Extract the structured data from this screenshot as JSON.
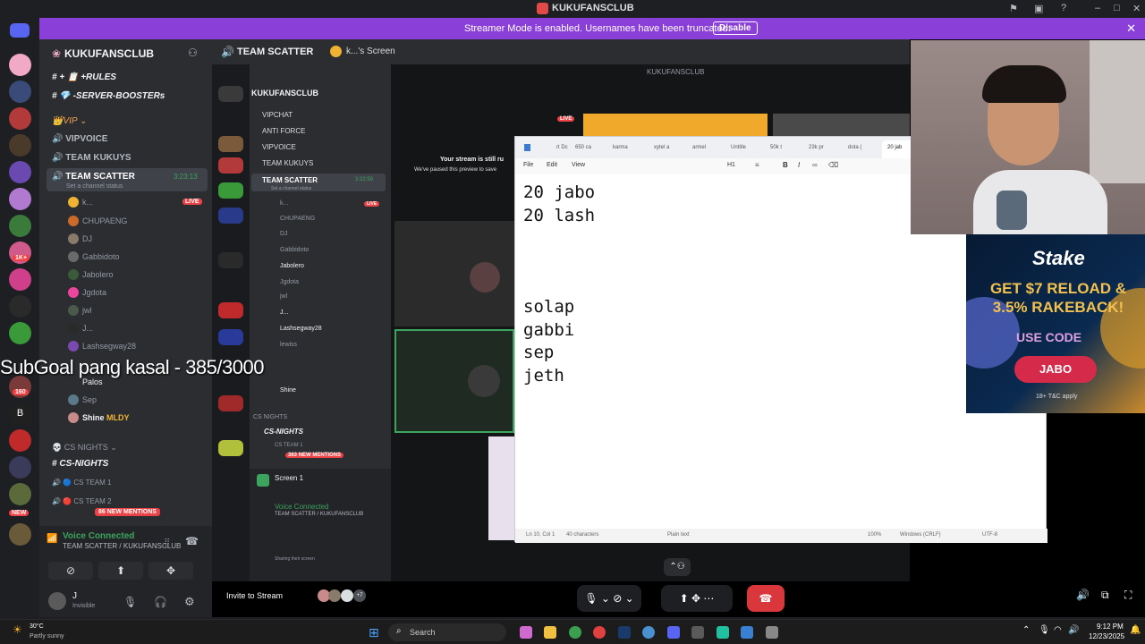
{
  "window": {
    "title": "KUKUFANSCLUB"
  },
  "streamer_bar": {
    "message": "Streamer Mode is enabled. Usernames have been truncated.",
    "button": "Disable"
  },
  "rail": {
    "badges": [
      "1K+",
      "160",
      "NEW"
    ]
  },
  "server": {
    "name": "KUKUFANSCLUB",
    "channels_top": [
      {
        "name": "+ 📋 +RULES"
      },
      {
        "name": "💎 -SERVER-BOOSTERs"
      }
    ],
    "category_vip": "VIP",
    "vip_channels": [
      "VIPVOICE",
      "TEAM KUKUYS",
      "TEAM SCATTER"
    ],
    "selected_channel": "TEAM SCATTER",
    "selected_time": "3:23:13",
    "channel_status": "Set a channel status",
    "voice_users": [
      {
        "name": "k...",
        "live": "LIVE"
      },
      {
        "name": "CHUPAENG"
      },
      {
        "name": "DJ"
      },
      {
        "name": "Gabbidoto"
      },
      {
        "name": "Jabolero"
      },
      {
        "name": "Jgdota"
      },
      {
        "name": "jwl"
      },
      {
        "name": "J..."
      },
      {
        "name": "Lashsegway28"
      },
      {
        "name": "Palos"
      },
      {
        "name": "Sep"
      },
      {
        "name": "Shine"
      }
    ],
    "shine_tag": "MLDY",
    "category_cs": "CS NIGHTS",
    "cs_channels": [
      "CS-NIGHTS",
      "CS TEAM 1",
      "CS TEAM 2"
    ],
    "new_mentions": "86 NEW MENTIONS"
  },
  "voice_panel": {
    "status": "Voice Connected",
    "location": "TEAM SCATTER / KUKUFANSCLUB"
  },
  "user_panel": {
    "name": "J",
    "status": "Invisible"
  },
  "main_header": {
    "channel": "TEAM SCATTER",
    "screen": "k...'s Screen"
  },
  "nested": {
    "server_title": "KUKUFANSCLUB",
    "channels": [
      "VIPCHAT",
      "ANTI FORCE",
      "VIPVOICE",
      "TEAM KUKUYS",
      "TEAM SCATTER"
    ],
    "selected_time": "3:22:59",
    "channel_status": "Set a channel status",
    "users": [
      "k...",
      "CHUPAENG",
      "DJ",
      "Gabbidoto",
      "Jabolero",
      "Jgdota",
      "jwl",
      "J...",
      "Lashsegway28",
      "lewiss",
      "Shine"
    ],
    "category": "CS NIGHTS",
    "cs_channel": "CS-NIGHTS",
    "cs_team": "CS TEAM 1",
    "new_mentions": "363 NEW MENTIONS",
    "screen_label": "Screen 1",
    "voice_status": "Voice Connected",
    "voice_location": "TEAM SCATTER / KUKUFANSCLUB",
    "sharing": "Sharing their screen",
    "stream_msg_1": "Your stream is still ru",
    "stream_msg_2": "We've paused this preview to save",
    "live": "LIVE",
    "kuku_label": "KUKUFANSCLUB"
  },
  "notepad": {
    "tabs": [
      "rt Dc",
      "650 ca",
      "karma",
      "xytel a",
      "armel",
      "Untitle",
      "50k t",
      "23k pr",
      "dota (",
      "20 jab"
    ],
    "menu": [
      "File",
      "Edit",
      "View"
    ],
    "heading": "H1",
    "content": "20 jabo\n20 lash\n\n\n\nsolap\ngabbi\nsep\njeth",
    "status": {
      "position": "Ln 10, Col 1",
      "chars": "40 characters",
      "format": "Plain text",
      "zoom": "100%",
      "eol": "Windows (CRLF)",
      "encoding": "UTF-8"
    }
  },
  "ad": {
    "brand": "Stake",
    "headline": "GET $7 RELOAD & 3.5% RAKEBACK!",
    "use_code": "USE CODE",
    "code": "JABO",
    "fine": "18+ T&C apply"
  },
  "overlay": {
    "subgoal": "SubGoal pang kasal - 385/3000"
  },
  "controls": {
    "invite": "Invite to Stream",
    "viewers_extra": "+7"
  },
  "taskbar": {
    "weather_temp": "30°C",
    "weather_desc": "Partly sunny",
    "search": "Search",
    "time": "9:12 PM",
    "date": "12/23/2025"
  }
}
